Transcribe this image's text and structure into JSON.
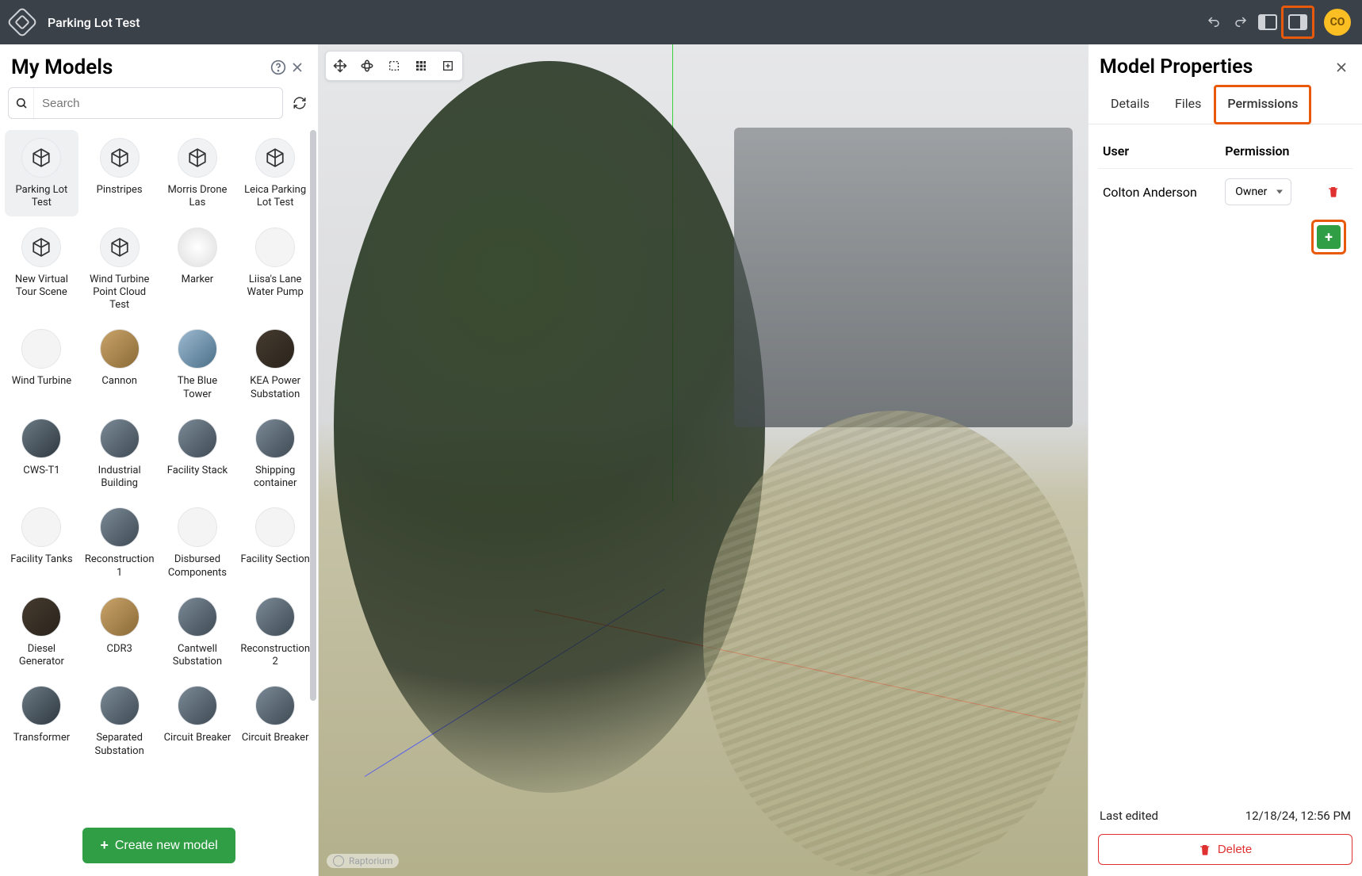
{
  "header": {
    "title": "Parking Lot Test",
    "avatar_initials": "CO"
  },
  "sidebar": {
    "title": "My Models",
    "search_placeholder": "Search",
    "create_label": "Create new model",
    "models": [
      {
        "label": "Parking Lot Test",
        "thumb": "cube",
        "active": true
      },
      {
        "label": "Pinstripes",
        "thumb": "cube"
      },
      {
        "label": "Morris Drone Las",
        "thumb": "cube"
      },
      {
        "label": "Leica Parking Lot Test",
        "thumb": "cube"
      },
      {
        "label": "New Virtual Tour Scene",
        "thumb": "cube"
      },
      {
        "label": "Wind Turbine Point Cloud Test",
        "thumb": "cube"
      },
      {
        "label": "Marker",
        "thumb": "img",
        "cls": "e"
      },
      {
        "label": "Liisa's Lane Water Pump",
        "thumb": "img",
        "cls": "light"
      },
      {
        "label": "Wind Turbine",
        "thumb": "img",
        "cls": "light"
      },
      {
        "label": "Cannon",
        "thumb": "img",
        "cls": "b"
      },
      {
        "label": "The Blue Tower",
        "thumb": "img",
        "cls": "c"
      },
      {
        "label": "KEA Power Substation",
        "thumb": "img",
        "cls": "d"
      },
      {
        "label": "CWS-T1",
        "thumb": "img",
        "cls": "f"
      },
      {
        "label": "Industrial Building",
        "thumb": "img",
        "cls": "a"
      },
      {
        "label": "Facility Stack",
        "thumb": "img",
        "cls": "a"
      },
      {
        "label": "Shipping container",
        "thumb": "img",
        "cls": "a"
      },
      {
        "label": "Facility Tanks",
        "thumb": "img",
        "cls": "light"
      },
      {
        "label": "Reconstruction 1",
        "thumb": "img",
        "cls": "a"
      },
      {
        "label": "Disbursed Components",
        "thumb": "img",
        "cls": "light"
      },
      {
        "label": "Facility Section",
        "thumb": "img",
        "cls": "light"
      },
      {
        "label": "Diesel Generator",
        "thumb": "img",
        "cls": "d"
      },
      {
        "label": "CDR3",
        "thumb": "img",
        "cls": "b"
      },
      {
        "label": "Cantwell Substation",
        "thumb": "img",
        "cls": "a"
      },
      {
        "label": "Reconstruction 2",
        "thumb": "img",
        "cls": "a"
      },
      {
        "label": "Transformer",
        "thumb": "img",
        "cls": "f"
      },
      {
        "label": "Separated Substation",
        "thumb": "img",
        "cls": "a"
      },
      {
        "label": "Circuit Breaker",
        "thumb": "img",
        "cls": "a"
      },
      {
        "label": "Circuit Breaker",
        "thumb": "img",
        "cls": "a"
      }
    ]
  },
  "viewport": {
    "watermark": "Raptorium"
  },
  "right_panel": {
    "title": "Model Properties",
    "tabs": {
      "details": "Details",
      "files": "Files",
      "permissions": "Permissions"
    },
    "perm_head_user": "User",
    "perm_head_perm": "Permission",
    "perm_rows": [
      {
        "user": "Colton Anderson",
        "permission": "Owner"
      }
    ],
    "meta_label": "Last edited",
    "meta_value": "12/18/24, 12:56 PM",
    "delete_label": "Delete"
  }
}
